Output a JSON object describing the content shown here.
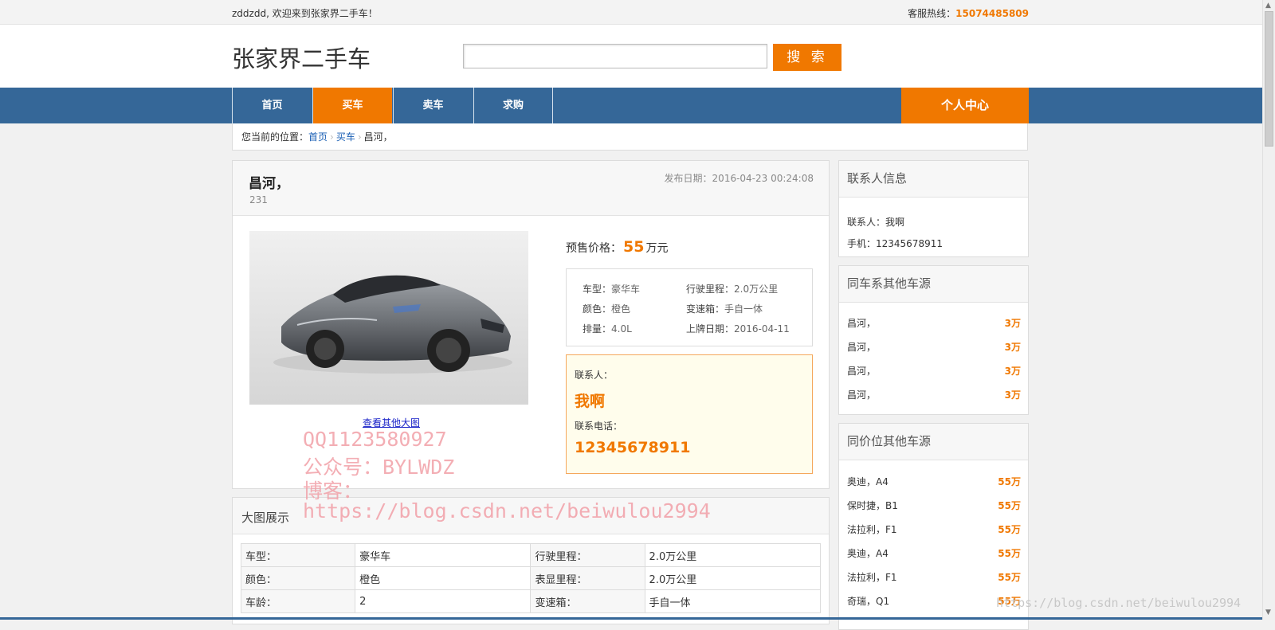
{
  "topbar": {
    "welcome": "zddzdd, 欢迎来到张家界二手车！",
    "hotline_label": "客服热线：",
    "hotline_number": "15074485809"
  },
  "header": {
    "logo": "张家界二手车",
    "search_placeholder": "",
    "search_button": "搜 索"
  },
  "nav": {
    "items": [
      {
        "label": "首页"
      },
      {
        "label": "买车"
      },
      {
        "label": "卖车"
      },
      {
        "label": "求购"
      }
    ],
    "active": "买车",
    "personal": "个人中心"
  },
  "breadcrumb": {
    "prefix": "您当前的位置：",
    "home": "首页",
    "section": "买车",
    "current": "昌河，"
  },
  "car": {
    "title": "昌河，",
    "subtitle": "231",
    "publish_date": "发布日期：2016-04-23 00:24:08",
    "view_more": "查看其他大图",
    "price_label": "预售价格：",
    "price_value": "55",
    "price_unit": "万元",
    "specs": [
      {
        "key": "车型：",
        "value": "豪华车"
      },
      {
        "key": "行驶里程：",
        "value": "2.0万公里"
      },
      {
        "key": "颜色：",
        "value": "橙色"
      },
      {
        "key": "变速箱：",
        "value": "手自一体"
      },
      {
        "key": "排量：",
        "value": "4.0L"
      },
      {
        "key": "上牌日期：",
        "value": "2016-04-11"
      }
    ],
    "contact_label": "联系人：",
    "contact_name": "我啊",
    "phone_label": "联系电话：",
    "phone_number": "12345678911"
  },
  "big_images": {
    "title": "大图展示",
    "table": [
      [
        "车型：",
        "豪华车",
        "行驶里程：",
        "2.0万公里"
      ],
      [
        "颜色：",
        "橙色",
        "表显里程：",
        "2.0万公里"
      ],
      [
        "车龄：",
        "2",
        "变速箱：",
        "手自一体"
      ]
    ]
  },
  "side_contact": {
    "title": "联系人信息",
    "name_line": "联系人：我啊",
    "phone_line": "手机：12345678911"
  },
  "side_same_series": {
    "title": "同车系其他车源",
    "items": [
      {
        "name": "昌河，",
        "price": "3万"
      },
      {
        "name": "昌河，",
        "price": "3万"
      },
      {
        "name": "昌河，",
        "price": "3万"
      },
      {
        "name": "昌河，",
        "price": "3万"
      }
    ]
  },
  "side_same_price": {
    "title": "同价位其他车源",
    "items": [
      {
        "name": "奥迪，A4",
        "price": "55万"
      },
      {
        "name": "保时捷，B1",
        "price": "55万"
      },
      {
        "name": "法拉利，F1",
        "price": "55万"
      },
      {
        "name": "奥迪，A4",
        "price": "55万"
      },
      {
        "name": "法拉利，F1",
        "price": "55万"
      },
      {
        "name": "奇瑞，Q1",
        "price": "55万"
      }
    ]
  },
  "watermark": {
    "line1": "QQ1123580927",
    "line2": "公众号：BYLWDZ",
    "line3": "博客：",
    "line4": "https://blog.csdn.net/beiwulou2994",
    "corner": "https://blog.csdn.net/beiwulou2994"
  },
  "colors": {
    "accent": "#f07800",
    "nav": "#356798",
    "link": "#1a5fb4"
  }
}
